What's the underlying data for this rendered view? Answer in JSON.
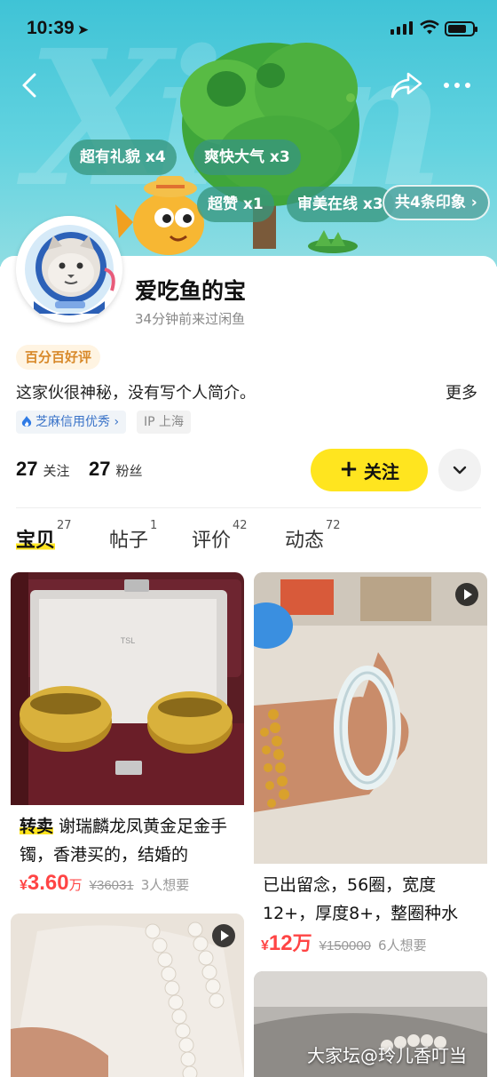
{
  "status_bar": {
    "time": "10:39"
  },
  "header": {
    "impression_tags": [
      {
        "label": "超有礼貌 x4"
      },
      {
        "label": "爽快大气 x3"
      },
      {
        "label": "超赞 x1"
      },
      {
        "label": "审美在线 x3"
      }
    ],
    "impression_total": "共4条印象 ›"
  },
  "profile": {
    "name": "爱吃鱼的宝",
    "last_seen": "34分钟前来过闲鱼",
    "rating_badge": "百分百好评",
    "bio": "这家伙很神秘，没有写个人简介。",
    "bio_more": "更多",
    "credit_badge": "芝麻信用优秀 ›",
    "ip_location": "IP 上海",
    "following_count": "27",
    "following_label": "关注",
    "followers_count": "27",
    "followers_label": "粉丝",
    "follow_button": "关注"
  },
  "tabs": [
    {
      "label": "宝贝",
      "count": "27",
      "active": true
    },
    {
      "label": "帖子",
      "count": "1"
    },
    {
      "label": "评价",
      "count": "42"
    },
    {
      "label": "动态",
      "count": "72"
    }
  ],
  "products": [
    {
      "tag": "转卖",
      "title": "谢瑞麟龙凤黄金足金手镯，香港买的，结婚的",
      "price_currency": "¥",
      "price_main": "3.60",
      "price_unit": "万",
      "original_price": "¥36031",
      "wants": "3人想要",
      "has_video": false
    },
    {
      "tag": "",
      "title": "已出留念，56圈，宽度12+，厚度8+，整圈种水",
      "price_currency": "¥",
      "price_main": "12",
      "price_unit": "万",
      "original_price": "¥150000",
      "wants": "6人想要",
      "has_video": true
    },
    {
      "has_video": true
    },
    {
      "has_video": false
    }
  ],
  "watermark": "大家坛@玲儿香叮当",
  "colors": {
    "accent_yellow": "#ffe51f",
    "price_red": "#ff4444",
    "banner_teal": "#4ccad9"
  }
}
